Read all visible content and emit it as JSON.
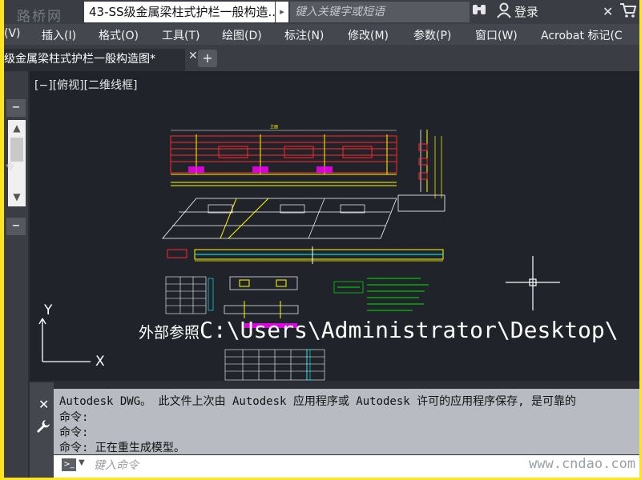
{
  "titlebar": {
    "watermark_logo": "路桥网",
    "title": "43-SS级金属梁柱式护栏一般构造...",
    "search_placeholder": "键入关键字或短语",
    "login_label": "登录",
    "icons": [
      "binoculars-icon",
      "user-icon",
      "close-icon",
      "cart-icon"
    ]
  },
  "menu": {
    "items": [
      "(V)",
      "插入(I)",
      "格式(O)",
      "工具(T)",
      "绘图(D)",
      "标注(N)",
      "修改(M)",
      "参数(P)",
      "窗口(W)",
      "Acrobat 标记(C"
    ]
  },
  "tabs": {
    "active_label": "级金属梁柱式护栏一般构造图*",
    "close_symbol": "✕",
    "add_symbol": "+"
  },
  "leftpanel": {
    "buttons": [
      "−",
      "−",
      "−"
    ],
    "side_char": "令"
  },
  "canvas": {
    "view_label": "[−][俯视][二维线框]",
    "xref_label": "外部参照",
    "xref_path": "C:\\Users\\Administrator\\Desktop\\",
    "ucs_x": "X",
    "ucs_y": "Y"
  },
  "command": {
    "history": [
      "Autodesk DWG。  此文件上次由 Autodesk 应用程序或 Autodesk 许可的应用程序保存, 是可靠的",
      "命令:",
      "命令:",
      "命令: 正在重生成模型。"
    ],
    "input_placeholder": "键入命令",
    "prompt_symbol": ">_"
  },
  "watermark": "www.cndao.com",
  "colors": {
    "frame_border": "#FFE51E",
    "canvas_bg": "#20232a",
    "drawing_yellow": "#ffff00",
    "drawing_red": "#ff2a2a",
    "drawing_green": "#00e600",
    "drawing_magenta": "#ff00ff",
    "drawing_cyan": "#00ffff"
  }
}
